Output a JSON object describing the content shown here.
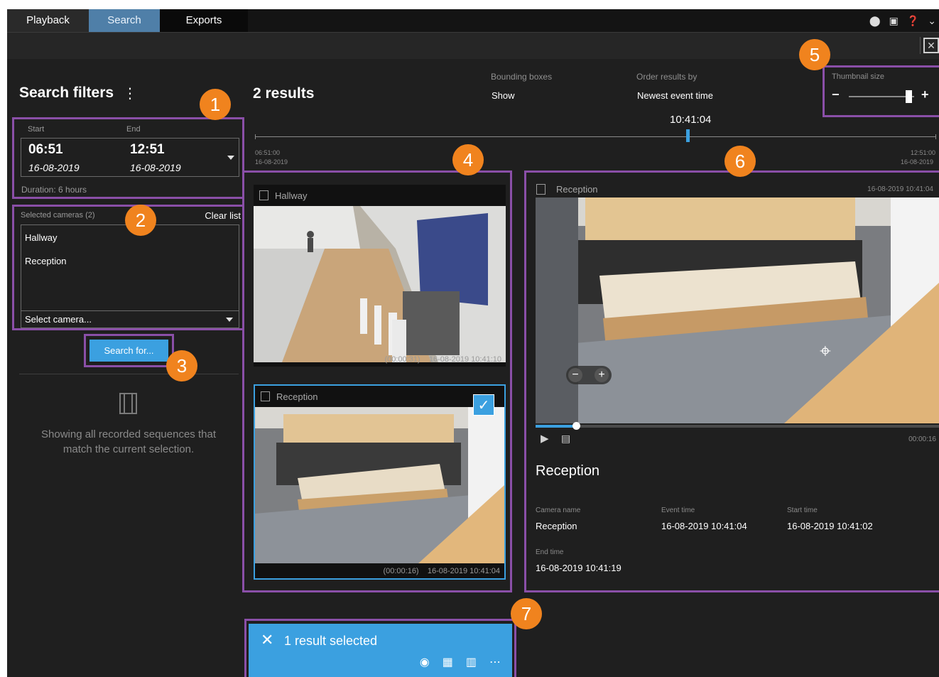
{
  "tabs": [
    {
      "label": "Playback"
    },
    {
      "label": "Search"
    },
    {
      "label": "Exports"
    }
  ],
  "top_icons": [
    "pin-icon",
    "screens-icon",
    "help-icon",
    "chevron-down-icon"
  ],
  "filters": {
    "title": "Search filters",
    "menu_glyph": "⋮",
    "start_label": "Start",
    "end_label": "End",
    "start_time": "06:51",
    "end_time": "12:51",
    "start_date": "16-08-2019",
    "end_date": "16-08-2019",
    "duration": "Duration: 6 hours",
    "cameras_label": "Selected cameras (2)",
    "clear_list": "Clear list",
    "cameras": [
      "Hallway",
      "Reception"
    ],
    "select_camera": "Select camera...",
    "search_button": "Search for...",
    "empty_text": "Showing all recorded sequences that match the current selection."
  },
  "results": {
    "title": "2 results",
    "bounding_boxes_label": "Bounding boxes",
    "bounding_boxes_value": "Show",
    "order_label": "Order results by",
    "order_value": "Newest event time",
    "thumbnail_label": "Thumbnail size",
    "thumbnail_minus": "−",
    "thumbnail_plus": "+",
    "thumbnail_level": 0.92,
    "timeline_now": "10:41:04",
    "timeline_start_time": "06:51:00",
    "timeline_start_date": "16-08-2019",
    "timeline_end_time": "12:51:00",
    "timeline_end_date": "16-08-2019",
    "items": [
      {
        "camera": "Hallway",
        "duration": "(00:00:31)",
        "timestamp": "16-08-2019 10:41:10",
        "selected": false
      },
      {
        "camera": "Reception",
        "duration": "(00:00:16)",
        "timestamp": "16-08-2019 10:41:04",
        "selected": true
      }
    ]
  },
  "preview": {
    "camera": "Reception",
    "timestamp": "16-08-2019 10:41:04",
    "duration": "00:00:16",
    "progress": 0.1,
    "title": "Reception",
    "camera_name_label": "Camera name",
    "camera_name": "Reception",
    "event_time_label": "Event time",
    "event_time": "16-08-2019 10:41:04",
    "start_time_label": "Start time",
    "start_time": "16-08-2019 10:41:02",
    "end_time_label": "End time",
    "end_time": "16-08-2019 10:41:19"
  },
  "action_bar": {
    "text": "1 result selected",
    "icons": [
      "export-icon",
      "add-to-view-icon",
      "pdf-report-icon",
      "more-icon"
    ]
  },
  "markers": [
    "1",
    "2",
    "3",
    "4",
    "5",
    "6",
    "7"
  ],
  "colors": {
    "accent": "#3ba0e0",
    "highlight_border": "#8a4fa8",
    "marker": "#f0831e",
    "background": "#1f1f1f"
  }
}
